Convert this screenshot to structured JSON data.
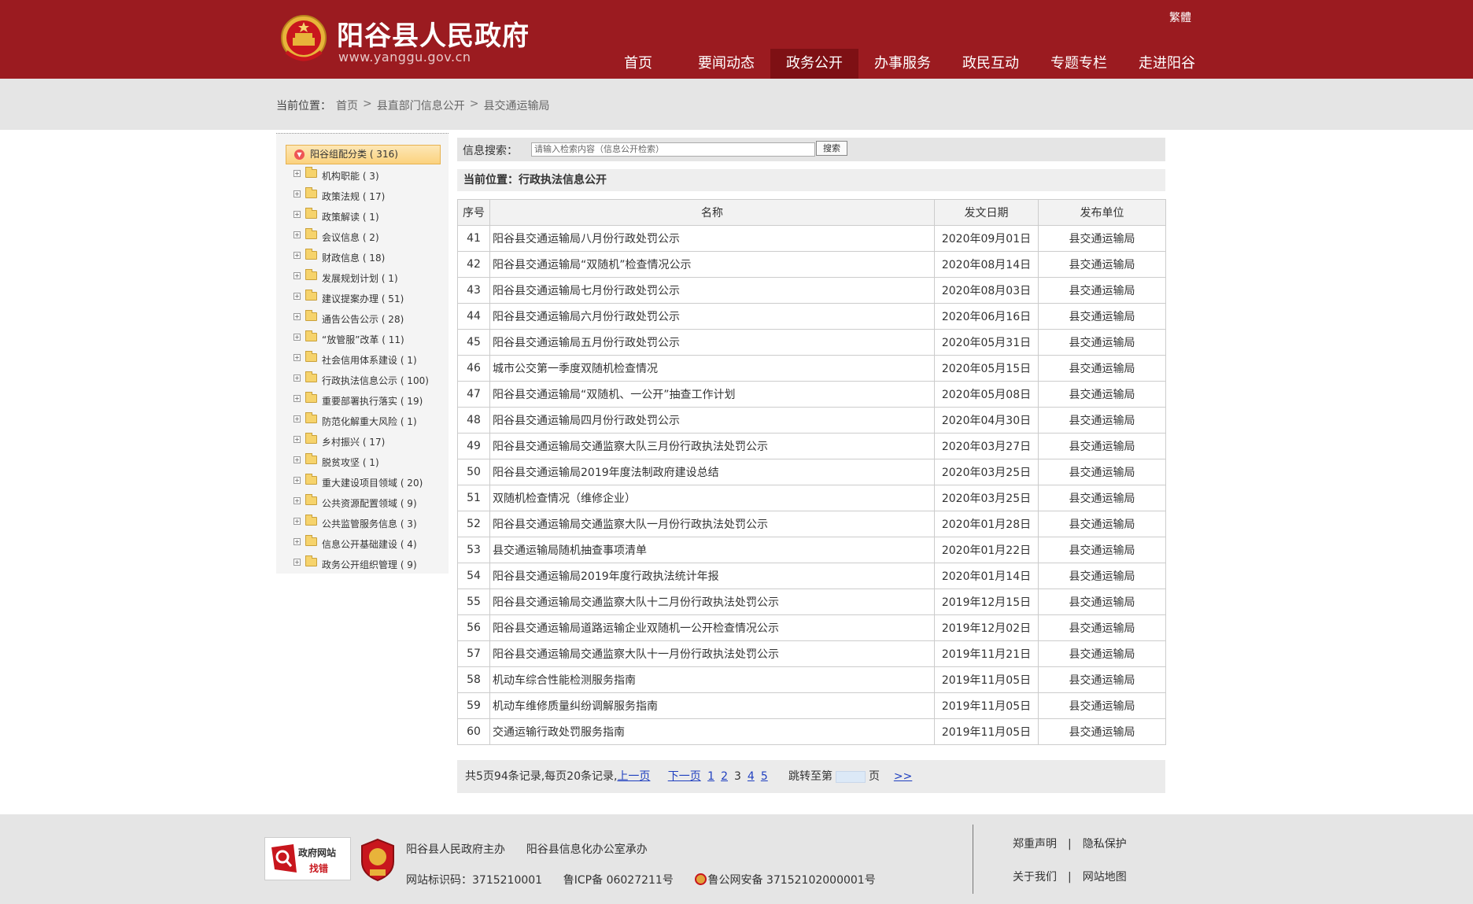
{
  "header": {
    "title": "阳谷县人民政府",
    "url": "www.yanggu.gov.cn",
    "lang_switch": "繁體",
    "nav": [
      "首页",
      "要闻动态",
      "政务公开",
      "办事服务",
      "政民互动",
      "专题专栏",
      "走进阳谷"
    ],
    "nav_active": "政务公开",
    "brand_color": "#9b1b20"
  },
  "breadcrumb": {
    "label": "当前位置：",
    "items": [
      "首页",
      "县直部门信息公开",
      "县交通运输局"
    ],
    "sep": ">"
  },
  "sidebar": {
    "root": "阳谷组配分类 ( 316)",
    "items": [
      "机构职能 ( 3)",
      "政策法规 ( 17)",
      "政策解读 ( 1)",
      "会议信息 ( 2)",
      "财政信息 ( 18)",
      "发展规划计划 ( 1)",
      "建议提案办理 ( 51)",
      "通告公告公示 ( 28)",
      "“放管服”改革 ( 11)",
      "社会信用体系建设 ( 1)",
      "行政执法信息公示 ( 100)",
      "重要部署执行落实 ( 19)",
      "防范化解重大风险 ( 1)",
      "乡村振兴 ( 17)",
      "脱贫攻坚 ( 1)",
      "重大建设项目领域 ( 20)",
      "公共资源配置领域 ( 9)",
      "公共监管服务信息 ( 3)",
      "信息公开基础建设 ( 4)",
      "政务公开组织管理 ( 9)"
    ]
  },
  "search": {
    "label": "信息搜索：",
    "placeholder": "请输入检索内容（信息公开检索）",
    "button": "搜索"
  },
  "position": "当前位置：行政执法信息公开",
  "table": {
    "headers": [
      "序号",
      "名称",
      "发文日期",
      "发布单位"
    ],
    "rows": [
      [
        "41",
        "阳谷县交通运输局八月份行政处罚公示",
        "2020年09月01日",
        "县交通运输局"
      ],
      [
        "42",
        "阳谷县交通运输局“双随机”检查情况公示",
        "2020年08月14日",
        "县交通运输局"
      ],
      [
        "43",
        "阳谷县交通运输局七月份行政处罚公示",
        "2020年08月03日",
        "县交通运输局"
      ],
      [
        "44",
        "阳谷县交通运输局六月份行政处罚公示",
        "2020年06月16日",
        "县交通运输局"
      ],
      [
        "45",
        "阳谷县交通运输局五月份行政处罚公示",
        "2020年05月31日",
        "县交通运输局"
      ],
      [
        "46",
        "城市公交第一季度双随机检查情况",
        "2020年05月15日",
        "县交通运输局"
      ],
      [
        "47",
        "阳谷县交通运输局“双随机、一公开”抽查工作计划",
        "2020年05月08日",
        "县交通运输局"
      ],
      [
        "48",
        "阳谷县交通运输局四月份行政处罚公示",
        "2020年04月30日",
        "县交通运输局"
      ],
      [
        "49",
        "阳谷县交通运输局交通监察大队三月份行政执法处罚公示",
        "2020年03月27日",
        "县交通运输局"
      ],
      [
        "50",
        "阳谷县交通运输局2019年度法制政府建设总结",
        "2020年03月25日",
        "县交通运输局"
      ],
      [
        "51",
        "双随机检查情况（维修企业）",
        "2020年03月25日",
        "县交通运输局"
      ],
      [
        "52",
        "阳谷县交通运输局交通监察大队一月份行政执法处罚公示",
        "2020年01月28日",
        "县交通运输局"
      ],
      [
        "53",
        "县交通运输局随机抽查事项清单",
        "2020年01月22日",
        "县交通运输局"
      ],
      [
        "54",
        "阳谷县交通运输局2019年度行政执法统计年报",
        "2020年01月14日",
        "县交通运输局"
      ],
      [
        "55",
        "阳谷县交通运输局交通监察大队十二月份行政执法处罚公示",
        "2019年12月15日",
        "县交通运输局"
      ],
      [
        "56",
        "阳谷县交通运输局道路运输企业双随机一公开检查情况公示",
        "2019年12月02日",
        "县交通运输局"
      ],
      [
        "57",
        "阳谷县交通运输局交通监察大队十一月份行政执法处罚公示",
        "2019年11月21日",
        "县交通运输局"
      ],
      [
        "58",
        "机动车综合性能检测服务指南",
        "2019年11月05日",
        "县交通运输局"
      ],
      [
        "59",
        "机动车维修质量纠纷调解服务指南",
        "2019年11月05日",
        "县交通运输局"
      ],
      [
        "60",
        "交通运输行政处罚服务指南",
        "2019年11月05日",
        "县交通运输局"
      ]
    ]
  },
  "pager": {
    "summary": "共5页94条记录,每页20条记录,",
    "prev": "上一页",
    "next": "下一页",
    "pages": [
      "1",
      "2",
      "3",
      "4",
      "5"
    ],
    "current": "3",
    "jump_prefix": "跳转至第",
    "jump_suffix": "页",
    "go": ">>"
  },
  "footer": {
    "badge_title": "政府网站",
    "badge_sub": "找错",
    "badge2_text": "党政机关",
    "line1_a": "阳谷县人民政府主办",
    "line1_b": "阳谷县信息化办公室承办",
    "line2_a": "网站标识码：3715210001",
    "line2_b": "鲁ICP备 06027211号",
    "line2_c": "鲁公网安备 37152102000001号",
    "links_row1": [
      "郑重声明",
      "隐私保护"
    ],
    "links_row2": [
      "关于我们",
      "网站地图"
    ],
    "link_sep": "|"
  }
}
